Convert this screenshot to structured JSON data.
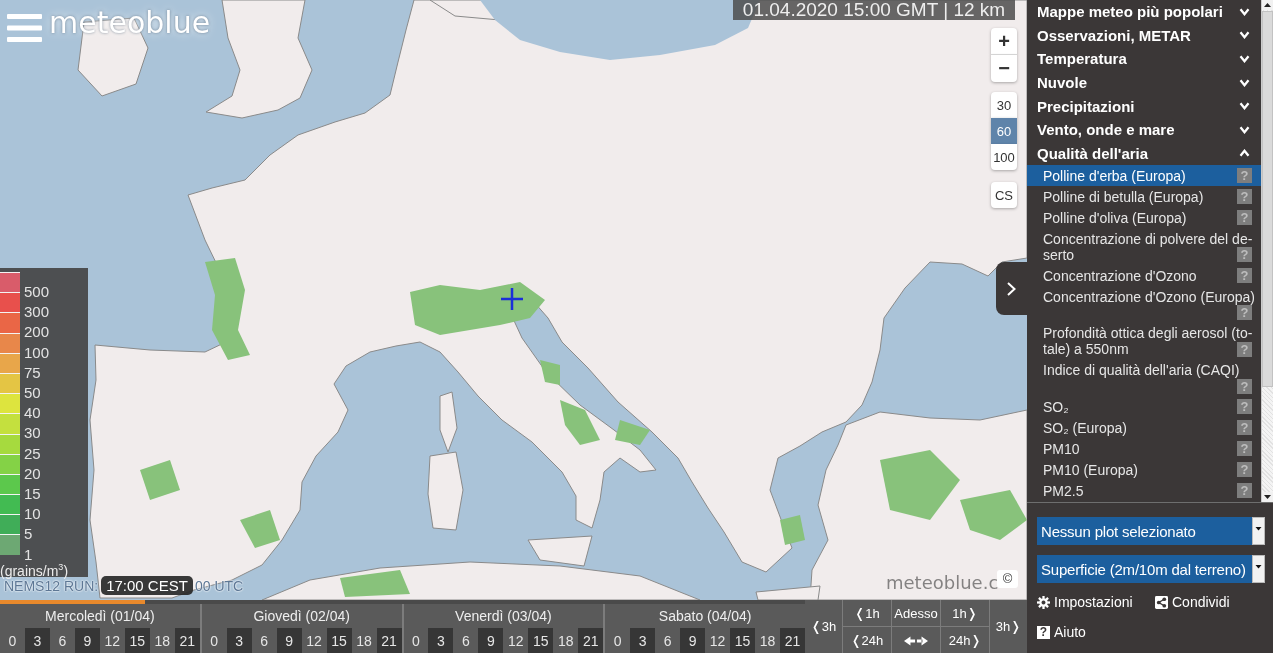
{
  "logo": "meteoblue",
  "map": {
    "time_label": "01.04.2020 15:00 GMT | 12 km",
    "zoom_in": "+",
    "zoom_out": "−",
    "resolutions": [
      {
        "label": "30",
        "selected": false
      },
      {
        "label": "60",
        "selected": true
      },
      {
        "label": "100",
        "selected": false
      }
    ],
    "cs_button": "CS",
    "legend": {
      "items": [
        {
          "label": "500",
          "color": "#d95c6a"
        },
        {
          "label": "300",
          "color": "#e8504c"
        },
        {
          "label": "200",
          "color": "#ea6646"
        },
        {
          "label": "100",
          "color": "#e8874a"
        },
        {
          "label": "75",
          "color": "#e8a64a"
        },
        {
          "label": "50",
          "color": "#e4c544"
        },
        {
          "label": "40",
          "color": "#dde43e"
        },
        {
          "label": "30",
          "color": "#c4e03e"
        },
        {
          "label": "25",
          "color": "#a6da3e"
        },
        {
          "label": "20",
          "color": "#84d246"
        },
        {
          "label": "15",
          "color": "#5cc84c"
        },
        {
          "label": "10",
          "color": "#42bb52"
        },
        {
          "label": "5",
          "color": "#40ad58"
        },
        {
          "label": "1",
          "color": "#6da873"
        }
      ],
      "unit": "(grains/m$^{3}$)"
    },
    "run_label": "NEMS12 RUN:",
    "time_tooltip": "17:00 CEST",
    "run_tail": "00 UTC",
    "attribution": "meteoblue.c",
    "copyright": "©"
  },
  "timeline": {
    "progress": {
      "level": 0.18
    },
    "days": [
      {
        "label": "Mercoledì (01/04)",
        "hours": [
          "0",
          "3",
          "6",
          "9",
          "12",
          "15",
          "18",
          "21"
        ]
      },
      {
        "label": "Giovedì (02/04)",
        "hours": [
          "0",
          "3",
          "6",
          "9",
          "12",
          "15",
          "18",
          "21"
        ]
      },
      {
        "label": "Venerdì (03/04)",
        "hours": [
          "0",
          "3",
          "6",
          "9",
          "12",
          "15",
          "18",
          "21"
        ]
      },
      {
        "label": "Sabato (04/04)",
        "hours": [
          "0",
          "3",
          "6",
          "9",
          "12",
          "15",
          "18",
          "21"
        ]
      }
    ],
    "nav": {
      "back_3h": "❬3h",
      "back_1h": "❬1h",
      "now": "Adesso",
      "forward_1h": "1h❭",
      "back_24h": "❬24h",
      "forward_24h": "24h❭",
      "forward_3h": "3h❭"
    }
  },
  "sidebar": {
    "categories": [
      {
        "label": "Mappe meteo più popolari",
        "expanded": false
      },
      {
        "label": "Osservazioni, METAR",
        "expanded": false
      },
      {
        "label": "Temperatura",
        "expanded": false
      },
      {
        "label": "Nuvole",
        "expanded": false
      },
      {
        "label": "Precipitazioni",
        "expanded": false
      },
      {
        "label": "Vento, onde e mare",
        "expanded": false
      },
      {
        "label": "Qualità dell'aria",
        "expanded": true,
        "items": [
          {
            "label": "Polline d'erba (Europa)",
            "selected": true,
            "help": "?"
          },
          {
            "label": "Polline di betulla (Europa)",
            "selected": false,
            "help": "?"
          },
          {
            "label": "Polline d'oliva (Europa)",
            "selected": false,
            "help": "?"
          },
          {
            "label": "Concentrazione di polvere del de-serto",
            "selected": false,
            "help": "?"
          },
          {
            "label": "Concentrazione d'Ozono",
            "selected": false,
            "help": "?"
          },
          {
            "label": "Concentrazione d'Ozono (Europa)",
            "selected": false,
            "help": "?"
          },
          {
            "label": "Profondità ottica degli aerosol (to-tale) a 550nm",
            "selected": false,
            "help": "?"
          },
          {
            "label": "Indice di qualità dell'aria (CAQI)",
            "selected": false,
            "help": "?"
          },
          {
            "label": "SO₂",
            "selected": false,
            "help": "?"
          },
          {
            "label": "SO₂ (Europa)",
            "selected": false,
            "help": "?"
          },
          {
            "label": "PM10",
            "selected": false,
            "help": "?"
          },
          {
            "label": "PM10 (Europa)",
            "selected": false,
            "help": "?"
          },
          {
            "label": "PM2.5",
            "selected": false,
            "help": "?"
          }
        ]
      }
    ],
    "selects": [
      {
        "value": "Nessun plot selezionato"
      },
      {
        "value": "Superficie (2m/10m dal terreno)"
      }
    ],
    "links": [
      {
        "kind": "settings",
        "label": "Impostazioni"
      },
      {
        "kind": "share",
        "label": "Condividi"
      },
      {
        "kind": "help",
        "label": "Aiuto",
        "icon_text": "?"
      }
    ]
  }
}
